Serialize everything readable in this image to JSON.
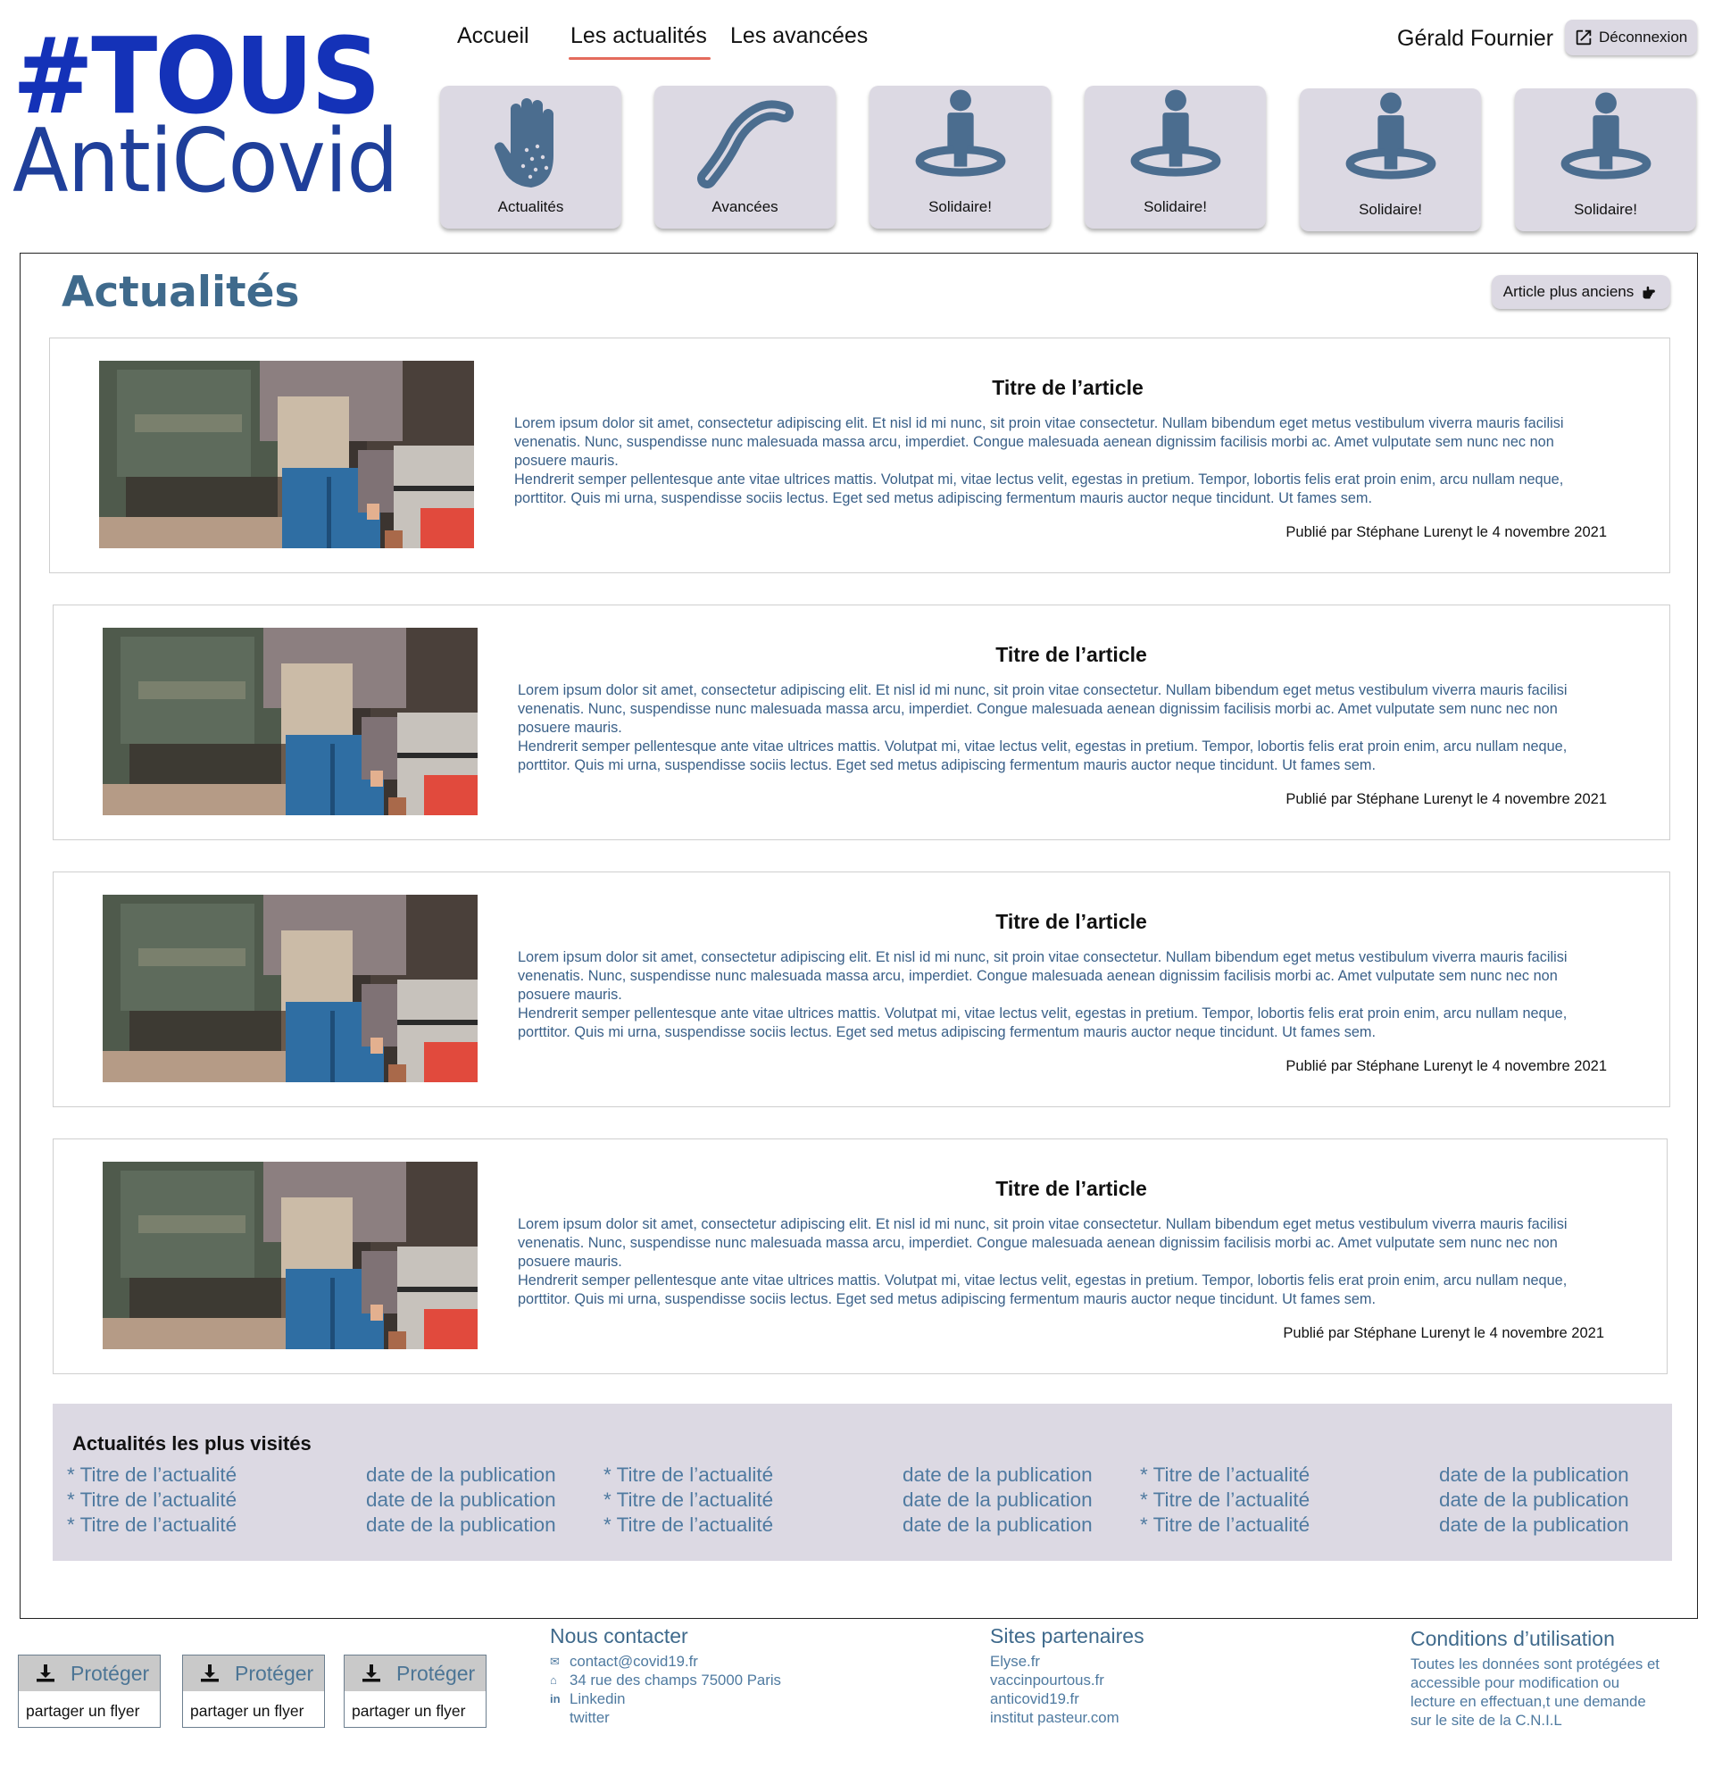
{
  "logo": {
    "line1": "#TOUS",
    "line2": "AntiCovid"
  },
  "nav": {
    "home": "Accueil",
    "news": "Les actualités",
    "progress": "Les avancées"
  },
  "user": {
    "name": "Gérald Fournier",
    "logout_label": "Déconnexion"
  },
  "tiles": [
    {
      "label": "Actualités",
      "icon": "hand-icon"
    },
    {
      "label": "Avancées",
      "icon": "bandage-icon"
    },
    {
      "label": "Solidaire!",
      "icon": "person-pin-icon"
    },
    {
      "label": "Solidaire!",
      "icon": "person-pin-icon"
    },
    {
      "label": "Solidaire!",
      "icon": "person-pin-icon"
    },
    {
      "label": "Solidaire!",
      "icon": "person-pin-icon"
    }
  ],
  "main": {
    "title": "Actualités",
    "older_label": "Article plus anciens",
    "articles": [
      {
        "title": "Titre de l’article",
        "p1": "Lorem ipsum dolor sit amet, consectetur adipiscing elit. Et nisl id mi nunc, sit proin vitae consectetur. Nullam bibendum eget metus vestibulum viverra mauris facilisi venenatis. Nunc, suspendisse nunc malesuada massa arcu, imperdiet. Congue malesuada aenean dignissim facilisis morbi ac. Amet vulputate sem nunc nec non posuere mauris.",
        "p2": "Hendrerit semper pellentesque ante vitae ultrices mattis. Volutpat mi, vitae lectus velit, egestas in pretium. Tempor, lobortis felis erat proin enim, arcu nullam neque, porttitor. Quis mi urna, suspendisse sociis lectus. Eget sed metus adipiscing fermentum mauris auctor neque tincidunt. Ut fames sem.",
        "meta": "Publié par Stéphane Lurenyt le 4 novembre 2021"
      },
      {
        "title": "Titre de l’article",
        "p1": "Lorem ipsum dolor sit amet, consectetur adipiscing elit. Et nisl id mi nunc, sit proin vitae consectetur. Nullam bibendum eget metus vestibulum viverra mauris facilisi venenatis. Nunc, suspendisse nunc malesuada massa arcu, imperdiet. Congue malesuada aenean dignissim facilisis morbi ac. Amet vulputate sem nunc nec non posuere mauris.",
        "p2": "Hendrerit semper pellentesque ante vitae ultrices mattis. Volutpat mi, vitae lectus velit, egestas in pretium. Tempor, lobortis felis erat proin enim, arcu nullam neque, porttitor. Quis mi urna, suspendisse sociis lectus. Eget sed metus adipiscing fermentum mauris auctor neque tincidunt. Ut fames sem.",
        "meta": "Publié par Stéphane Lurenyt le 4 novembre 2021"
      },
      {
        "title": "Titre de l’article",
        "p1": "Lorem ipsum dolor sit amet, consectetur adipiscing elit. Et nisl id mi nunc, sit proin vitae consectetur. Nullam bibendum eget metus vestibulum viverra mauris facilisi venenatis. Nunc, suspendisse nunc malesuada massa arcu, imperdiet. Congue malesuada aenean dignissim facilisis morbi ac. Amet vulputate sem nunc nec non posuere mauris.",
        "p2": "Hendrerit semper pellentesque ante vitae ultrices mattis. Volutpat mi, vitae lectus velit, egestas in pretium. Tempor, lobortis felis erat proin enim, arcu nullam neque, porttitor. Quis mi urna, suspendisse sociis lectus. Eget sed metus adipiscing fermentum mauris auctor neque tincidunt. Ut fames sem.",
        "meta": "Publié par Stéphane Lurenyt le 4 novembre 2021"
      },
      {
        "title": "Titre de l’article",
        "p1": "Lorem ipsum dolor sit amet, consectetur adipiscing elit. Et nisl id mi nunc, sit proin vitae consectetur. Nullam bibendum eget metus vestibulum viverra mauris facilisi venenatis. Nunc, suspendisse nunc malesuada massa arcu, imperdiet. Congue malesuada aenean dignissim facilisis morbi ac. Amet vulputate sem nunc nec non posuere mauris.",
        "p2": "Hendrerit semper pellentesque ante vitae ultrices mattis. Volutpat mi, vitae lectus velit, egestas in pretium. Tempor, lobortis felis erat proin enim, arcu nullam neque, porttitor. Quis mi urna, suspendisse sociis lectus. Eget sed metus adipiscing fermentum mauris auctor neque tincidunt. Ut fames sem.",
        "meta": "Publié par Stéphane Lurenyt le 4 novembre 2021"
      }
    ]
  },
  "popular": {
    "title": "Actualités les plus visités",
    "groups": [
      {
        "titles": [
          "* Titre de l’actualité",
          "* Titre de l’actualité",
          "* Titre de l’actualité"
        ],
        "dates": [
          "date de la publication",
          "date de la publication",
          "date de la publication"
        ]
      },
      {
        "titles": [
          "* Titre de l’actualité",
          "* Titre de l’actualité",
          "* Titre de l’actualité"
        ],
        "dates": [
          "date de la publication",
          "date de la publication",
          "date de la publication"
        ]
      },
      {
        "titles": [
          "* Titre de l’actualité",
          "* Titre de l’actualité",
          "* Titre de l’actualité"
        ],
        "dates": [
          "date de la publication",
          "date de la publication",
          "date de la publication"
        ]
      }
    ]
  },
  "flyers": [
    {
      "title": "Protéger",
      "subtitle": "partager un flyer"
    },
    {
      "title": "Protéger",
      "subtitle": "partager un flyer"
    },
    {
      "title": "Protéger",
      "subtitle": "partager un flyer"
    }
  ],
  "footer": {
    "contact": {
      "title": "Nous contacter",
      "email": "contact@covid19.fr",
      "address": "34 rue des champs 75000 Paris",
      "linkedin": "Linkedin",
      "twitter": "twitter"
    },
    "partners": {
      "title": "Sites partenaires",
      "links": [
        "Elyse.fr",
        "vaccinpourtous.fr",
        "anticovid19.fr",
        "institut pasteur.com"
      ]
    },
    "terms": {
      "title": "Conditions d’utilisation",
      "lines": [
        "Toutes les données sont protégées et",
        "accessible pour modification ou",
        "lecture en effectuan,t une demande",
        "sur le site de la C.N.I.L"
      ]
    }
  },
  "colors": {
    "logo_blue": "#1432b8",
    "accent_underline": "#e46b5c",
    "tile_bg": "#dcd9e3",
    "icon_blue": "#4b6d8f",
    "text_blue": "#3a6088"
  }
}
